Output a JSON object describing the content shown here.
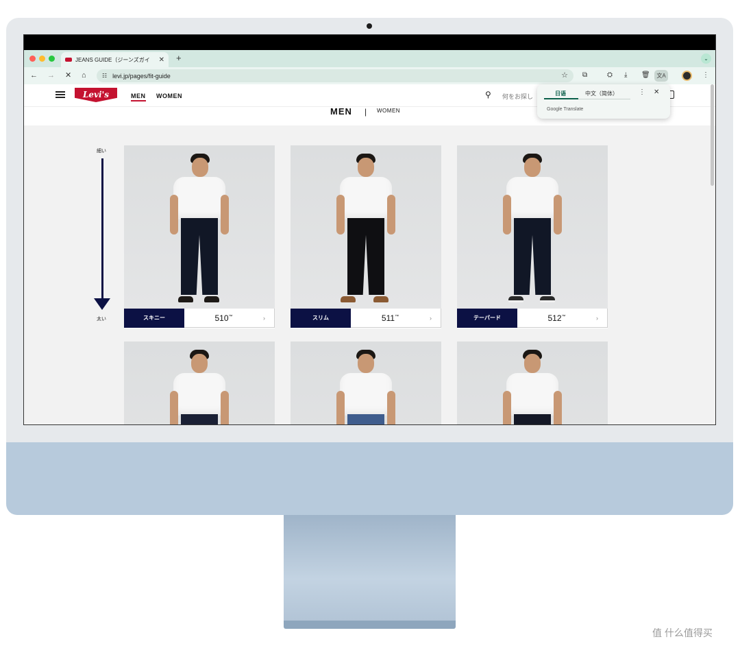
{
  "browser": {
    "tab_title": "JEANS GUIDE（ジーンズガイ",
    "tab_close": "✕",
    "new_tab": "+",
    "url": "levi.jp/pages/fit-guide"
  },
  "translate_popover": {
    "tab_source": "日语",
    "tab_target": "中文（简体）",
    "credit": "Google Translate"
  },
  "site": {
    "logo": "Levi's",
    "nav": {
      "men": "MEN",
      "women": "WOMEN"
    },
    "search_placeholder": "何をお探し"
  },
  "subnav": {
    "men": "MEN",
    "separator": "|",
    "women": "WOMEN"
  },
  "scale": {
    "thin": "細い",
    "thick": "太い"
  },
  "products": [
    {
      "fit": "スキニー",
      "number": "510",
      "tm": "™",
      "shoe_color": "#1e1a17"
    },
    {
      "fit": "スリム",
      "number": "511",
      "tm": "™",
      "shoe_color": "#8a5a33"
    },
    {
      "fit": "テーパード",
      "number": "512",
      "tm": "™",
      "shoe_color": "#2a2a2a"
    }
  ],
  "lower_rows": [
    {
      "jeans_color": "#1a2035"
    },
    {
      "jeans_color": "#3f5d8d"
    },
    {
      "jeans_color": "#141826"
    }
  ],
  "watermark": "值 什么值得买"
}
